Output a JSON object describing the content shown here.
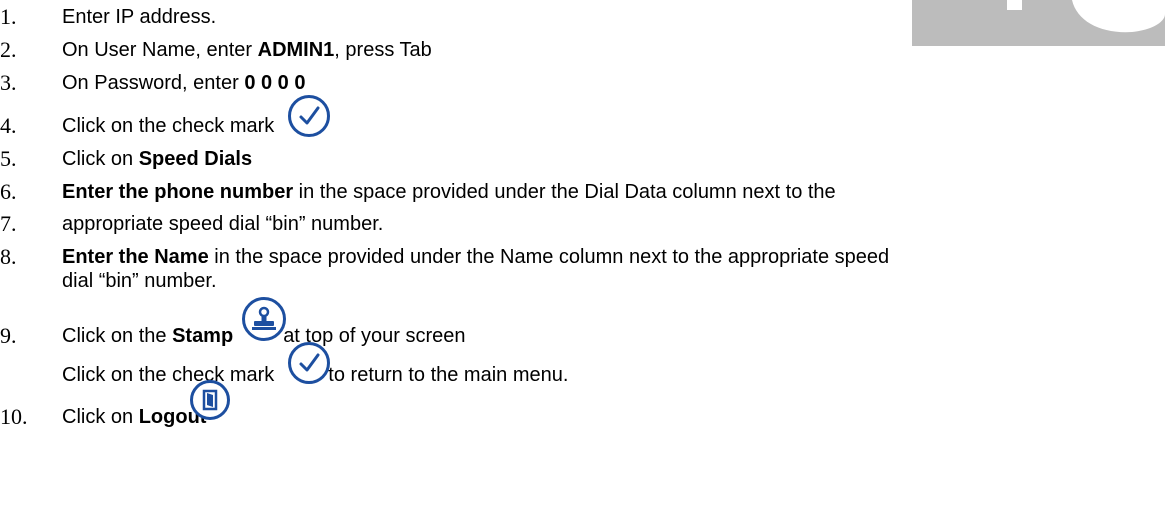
{
  "steps": [
    {
      "num": "1.",
      "text": "Enter IP address."
    },
    {
      "num": "2.",
      "pre": "On User Name, enter ",
      "bold": "ADMIN1",
      "post": ", press Tab"
    },
    {
      "num": "3.",
      "pre": "On Password, enter ",
      "bold": "0 0 0 0"
    },
    {
      "num": "4.",
      "text": "Click on the check mark"
    },
    {
      "num": "5.",
      "pre": "Click on ",
      "bold": "Speed Dials"
    },
    {
      "num": "6.",
      "bold": "Enter the phone number",
      "post": " in the space provided under the Dial Data column next to the"
    },
    {
      "num": "7.",
      "text": "appropriate speed dial “bin” number."
    },
    {
      "num": "8.",
      "bold": "Enter the Name",
      "post": " in the space provided under the Name column next to the appropriate speed",
      "cont": "dial “bin” number."
    },
    {
      "num": "9.",
      "pre": "Click on the ",
      "bold": "Stamp",
      "post": "at top of your screen"
    },
    {
      "num": "",
      "pre": "Click on the check mark",
      "post": "to return to the main menu."
    },
    {
      "num": "10.",
      "pre": "Click on ",
      "bold": "Logout"
    }
  ],
  "icons": {
    "check": "check-mark-icon",
    "stamp": "stamp-icon",
    "logout": "logout-door-icon"
  },
  "colors": {
    "icon_blue": "#1d4fa0",
    "corner_gray": "#bcbcbc"
  }
}
